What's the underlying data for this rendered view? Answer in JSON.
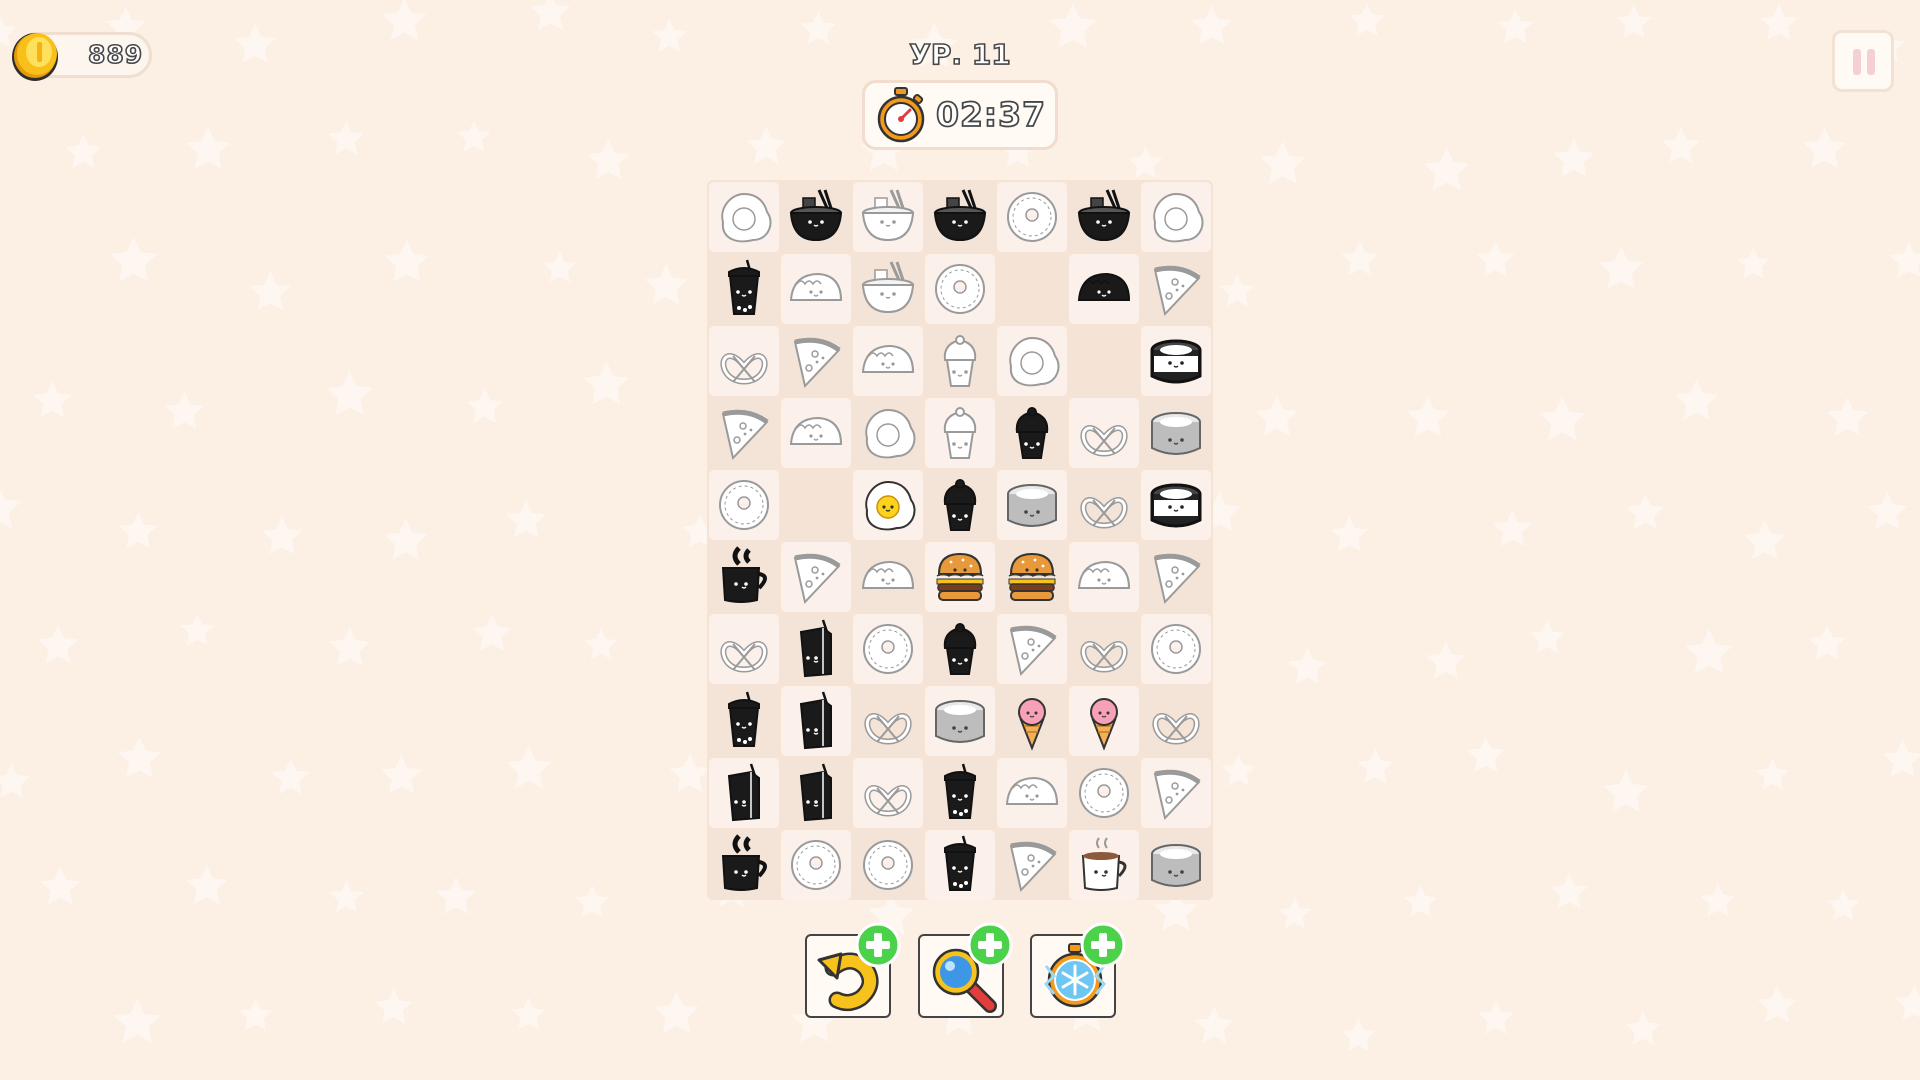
{
  "hud": {
    "coins": "889",
    "level": "УР. 11",
    "timer": "02:37"
  },
  "colors": {
    "background": "#fcefe4",
    "board": "#f5e3d5",
    "gold": "#f9c01a",
    "plus_green": "#4cd14a"
  },
  "board": {
    "columns": 7,
    "rows": 10,
    "grid": [
      [
        "egg-outline",
        "ramen-filled",
        "ramen-outline",
        "ramen-filled",
        "donut-outline",
        "ramen-filled",
        "egg-outline"
      ],
      [
        "boba-filled",
        "taco-outline",
        "ramen-outline",
        "donut-outline",
        "empty",
        "taco-filled",
        "pizza-outline"
      ],
      [
        "pretzel-outline",
        "pizza-outline",
        "taco-outline",
        "cupcake-outline",
        "egg-outline",
        "empty",
        "sushi-filled"
      ],
      [
        "pizza-outline",
        "taco-outline",
        "egg-outline",
        "cupcake-outline",
        "cupcake-filled",
        "pretzel-outline",
        "sushi-gray"
      ],
      [
        "donut-outline",
        "empty",
        "egg-color",
        "cupcake-filled",
        "sushi-gray",
        "pretzel-outline",
        "sushi-filled"
      ],
      [
        "coffee-filled",
        "pizza-outline",
        "taco-outline",
        "burger-color",
        "burger-color",
        "taco-outline",
        "pizza-outline"
      ],
      [
        "pretzel-outline",
        "juice-filled",
        "donut-outline",
        "cupcake-filled",
        "pizza-outline",
        "pretzel-outline",
        "donut-outline"
      ],
      [
        "boba-filled",
        "juice-filled",
        "pretzel-outline",
        "sushi-gray",
        "icecream-color",
        "icecream-color",
        "pretzel-outline"
      ],
      [
        "juice-filled",
        "juice-filled",
        "pretzel-outline",
        "boba-filled",
        "taco-outline",
        "donut-outline",
        "pizza-outline"
      ],
      [
        "coffee-filled",
        "donut-outline",
        "donut-outline",
        "boba-filled",
        "pizza-outline",
        "coffee-color",
        "sushi-gray"
      ]
    ]
  },
  "boosters": [
    {
      "name": "undo",
      "icon": "undo-arrow-icon"
    },
    {
      "name": "hint",
      "icon": "magnifier-icon"
    },
    {
      "name": "freeze",
      "icon": "freeze-stopwatch-icon"
    }
  ]
}
